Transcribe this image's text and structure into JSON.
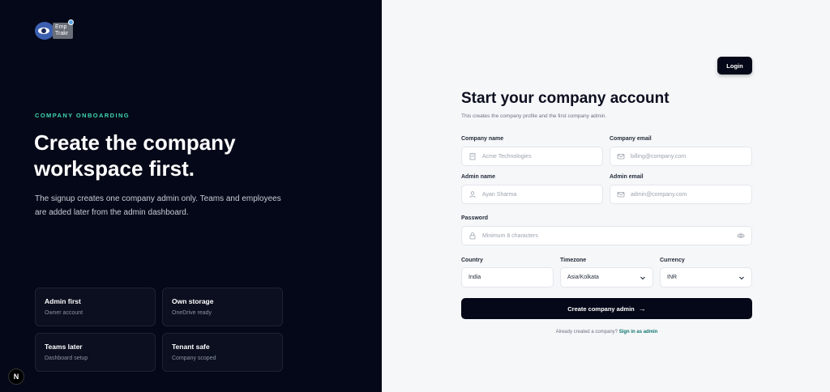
{
  "brand": {
    "logo_line1": "Emp",
    "logo_line2": "Trakr"
  },
  "left": {
    "kicker": "COMPANY ONBOARDING",
    "headline": "Create the company workspace first.",
    "lead": "The signup creates one company admin only. Teams and employees are added later from the admin dashboard.",
    "cards": [
      {
        "title": "Admin first",
        "sub": "Owner account"
      },
      {
        "title": "Own storage",
        "sub": "OneDrive ready"
      },
      {
        "title": "Teams later",
        "sub": "Dashboard setup"
      },
      {
        "title": "Tenant safe",
        "sub": "Company scoped"
      }
    ],
    "badge": "N"
  },
  "right": {
    "login_label": "Login",
    "title": "Start your company account",
    "subtitle": "This creates the company profile and the first company admin.",
    "fields": {
      "company_name": {
        "label": "Company name",
        "placeholder": "Acme Technologies",
        "icon": "building-icon"
      },
      "company_email": {
        "label": "Company email",
        "placeholder": "billing@company.com",
        "icon": "mail-icon"
      },
      "admin_name": {
        "label": "Admin name",
        "placeholder": "Ayan Sharma",
        "icon": "user-icon"
      },
      "admin_email": {
        "label": "Admin email",
        "placeholder": "admin@company.com",
        "icon": "mail-icon"
      },
      "password": {
        "label": "Password",
        "placeholder": "Minimum 8 characters",
        "icon": "lock-icon"
      },
      "country": {
        "label": "Country",
        "value": "India"
      },
      "timezone": {
        "label": "Timezone",
        "value": "Asia/Kolkata"
      },
      "currency": {
        "label": "Currency",
        "value": "INR"
      }
    },
    "submit_label": "Create company admin",
    "footer_text": "Already created a company?",
    "footer_link": "Sign in as admin"
  },
  "colors": {
    "dark": "#050818",
    "accent": "#3dd6b0",
    "link": "#0f766e",
    "panel": "#f6f7f9"
  }
}
